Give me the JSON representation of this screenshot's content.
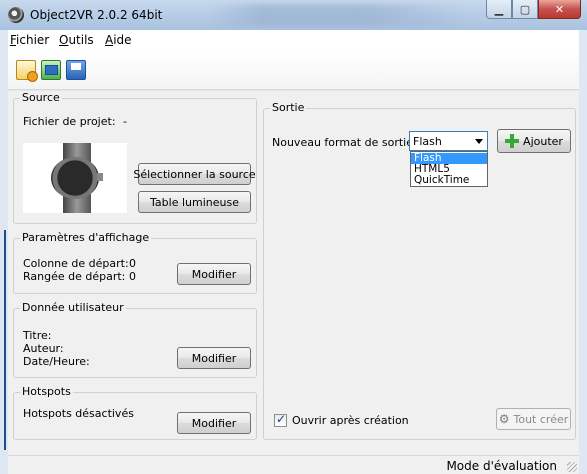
{
  "window": {
    "title": "Object2VR 2.0.2 64bit"
  },
  "menu": {
    "fichier_ul": "F",
    "fichier_rest": "ichier",
    "outils_ul": "O",
    "outils_rest": "utils",
    "aide_ul": "A",
    "aide_rest": "ide"
  },
  "toolbar": {
    "icons": [
      "new-project-icon",
      "open-project-icon",
      "save-project-icon"
    ]
  },
  "source": {
    "title": "Source",
    "project_label": "Fichier de projet:",
    "project_value": "-",
    "select_button": "Sélectionner la source",
    "lightbox_button": "Table lumineuse"
  },
  "display": {
    "title": "Paramètres d'affichage",
    "start_column_label": "Colonne de départ:",
    "start_column_value": "0",
    "start_row_label": "Rangée de départ:",
    "start_row_value": "0",
    "modify_button": "Modifier"
  },
  "userdata": {
    "title": "Donnée utilisateur",
    "title_label": "Titre:",
    "author_label": "Auteur:",
    "date_label": "Date/Heure:",
    "modify_button": "Modifier"
  },
  "hotspots": {
    "title": "Hotspots",
    "status": "Hotspots désactivés",
    "modify_button": "Modifier"
  },
  "output": {
    "title": "Sortie",
    "format_label": "Nouveau format de sortie:",
    "format_selected": "Flash",
    "format_options": [
      "Flash",
      "HTML5",
      "QuickTime"
    ],
    "add_button": "Ajouter",
    "open_after_label": "Ouvrir après création",
    "open_after_checked": true,
    "create_all_button": "Tout créer"
  },
  "status": {
    "text": "Mode d'évaluation"
  }
}
